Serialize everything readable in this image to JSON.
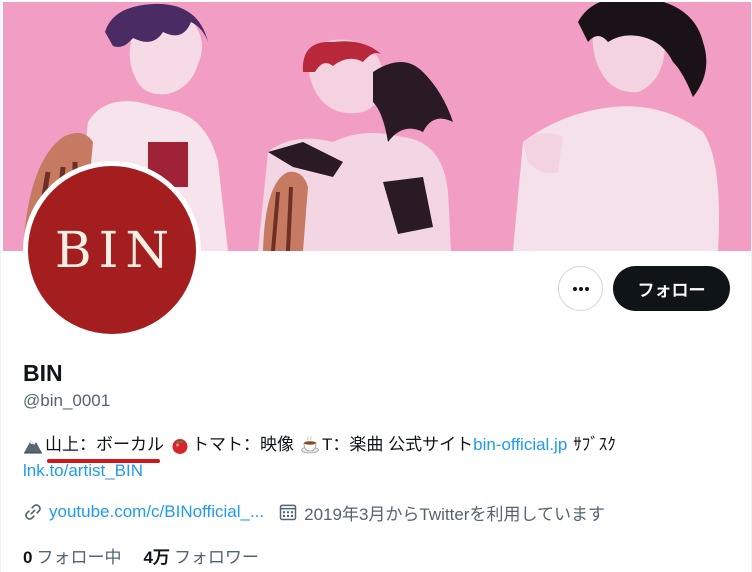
{
  "profile": {
    "avatar_text": "BIN",
    "display_name": "BIN",
    "handle": "@bin_0001"
  },
  "actions": {
    "follow_label": "フォロー",
    "more_icon": "more-horizontal-icon"
  },
  "bio": {
    "line1": {
      "emoji1": "mountain-emoji",
      "text1": "山上：ボーカル",
      "emoji2": "tomato-emoji",
      "text2": "トマト：映像",
      "emoji3": "tea-emoji",
      "text3": "T：楽曲 公式サイト",
      "link1": "bin-official.jp",
      "text4": "ｻﾌﾞｽｸ"
    },
    "line2": {
      "link2": "lnk.to/artist_BIN"
    }
  },
  "meta": {
    "website": "youtube.com/c/BINofficial_...",
    "joined": "2019年3月からTwitterを利用しています"
  },
  "stats": {
    "following_count": "0",
    "following_label": "フォロー中",
    "followers_count": "4万",
    "followers_label": "フォロワー"
  },
  "colors": {
    "banner_pink": "#f29ec4",
    "avatar_red": "#a41e1f",
    "link_blue": "#1d9bf0",
    "underline_red": "#d0161b"
  }
}
